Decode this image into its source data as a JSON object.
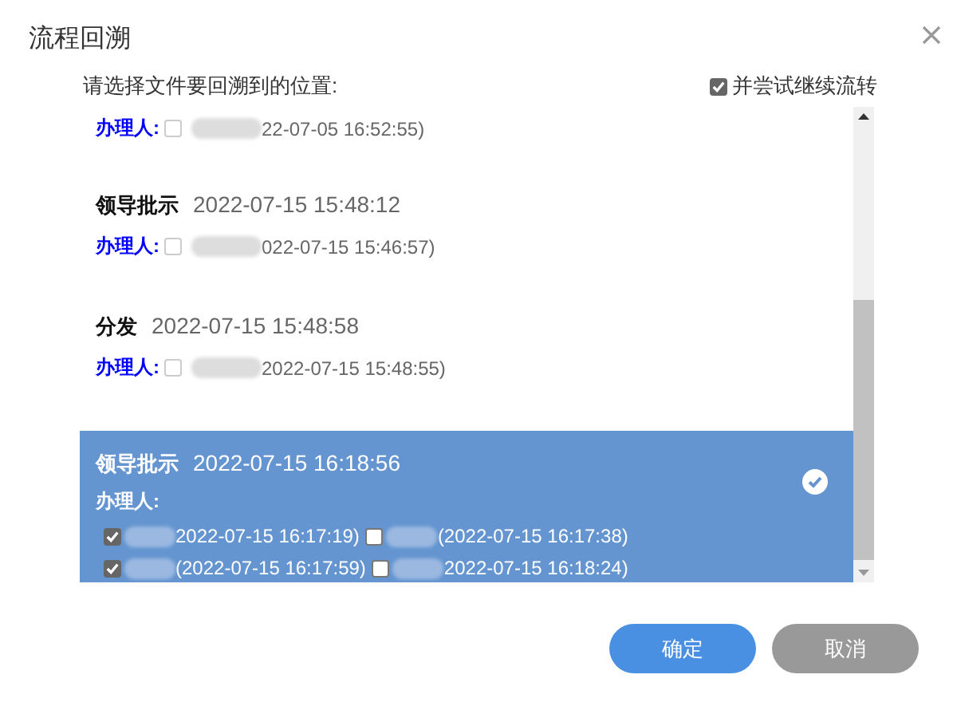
{
  "dialog": {
    "title": "流程回溯",
    "prompt": "请选择文件要回溯到的位置:",
    "continue_option": {
      "label": "并尝试继续流转",
      "checked": true
    }
  },
  "steps": [
    {
      "selected": false,
      "handler_label": "办理人:",
      "handlers": [
        {
          "checked": false,
          "time": "22-07-05 16:52:55)"
        }
      ]
    },
    {
      "name": "领导批示",
      "time": "2022-07-15 15:48:12",
      "selected": false,
      "handler_label": "办理人:",
      "handlers": [
        {
          "checked": false,
          "time": "022-07-15 15:46:57)"
        }
      ]
    },
    {
      "name": "分发",
      "time": "2022-07-15 15:48:58",
      "selected": false,
      "handler_label": "办理人:",
      "handlers": [
        {
          "checked": false,
          "time": "2022-07-15 15:48:55)"
        }
      ]
    },
    {
      "name": "领导批示",
      "time": "2022-07-15 16:18:56",
      "selected": true,
      "handler_label": "办理人:",
      "handlers": [
        {
          "checked": true,
          "time": "2022-07-15 16:17:19)"
        },
        {
          "checked": false,
          "time": "(2022-07-15 16:17:38)"
        },
        {
          "checked": true,
          "time": "(2022-07-15 16:17:59)"
        },
        {
          "checked": false,
          "time": "2022-07-15 16:18:24)"
        }
      ]
    }
  ],
  "buttons": [
    {
      "label": "确定",
      "kind": "primary"
    },
    {
      "label": "取消",
      "kind": "secondary"
    }
  ]
}
